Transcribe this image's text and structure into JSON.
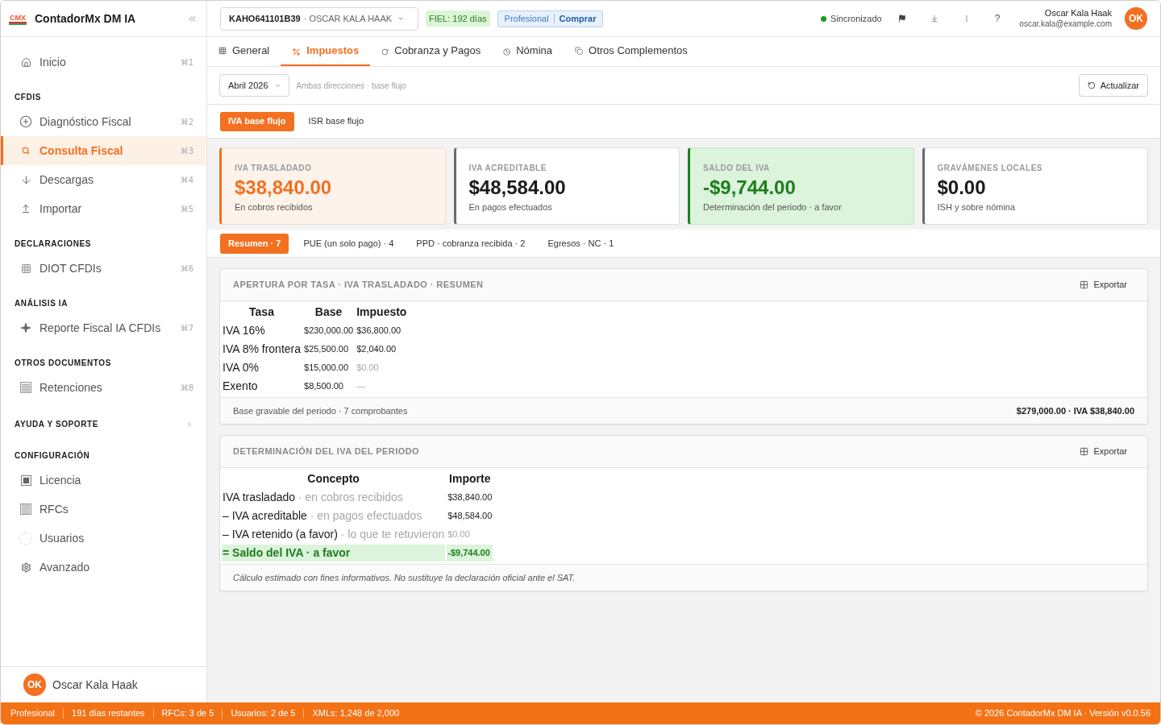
{
  "sidebar": {
    "logo": "CMX",
    "title": "ContadorMx DM IA",
    "nav": [
      {
        "kind": "item",
        "label": "Inicio",
        "shortcut": "⌘1",
        "selected": false
      },
      {
        "kind": "section",
        "label": "CFDIS"
      },
      {
        "kind": "item",
        "label": "Diagnóstico Fiscal",
        "shortcut": "⌘2",
        "selected": false
      },
      {
        "kind": "item",
        "label": "Consulta Fiscal",
        "shortcut": "⌘3",
        "selected": true
      },
      {
        "kind": "item",
        "label": "Descargas",
        "shortcut": "⌘4",
        "selected": false
      },
      {
        "kind": "item",
        "label": "Importar",
        "shortcut": "⌘5",
        "selected": false
      },
      {
        "kind": "section",
        "label": "DECLARACIONES"
      },
      {
        "kind": "item",
        "label": "DIOT CFDIs",
        "shortcut": "⌘6",
        "selected": false
      },
      {
        "kind": "section",
        "label": "ANÁLISIS IA"
      },
      {
        "kind": "item",
        "label": "Reporte Fiscal IA CFDIs",
        "shortcut": "⌘7",
        "selected": false
      },
      {
        "kind": "section",
        "label": "OTROS DOCUMENTOS"
      },
      {
        "kind": "item",
        "label": "Retenciones",
        "shortcut": "⌘8",
        "selected": false
      },
      {
        "kind": "group",
        "label": "AYUDA Y SOPORTE",
        "expanded": false
      },
      {
        "kind": "section",
        "label": "CONFIGURACIÓN"
      },
      {
        "kind": "item",
        "label": "Licencia",
        "selected": false
      },
      {
        "kind": "item",
        "label": "RFCs",
        "selected": false
      },
      {
        "kind": "item",
        "label": "Usuarios",
        "selected": false
      },
      {
        "kind": "item",
        "label": "Avanzado",
        "selected": false
      }
    ],
    "user": {
      "initials": "OK",
      "name": "Oscar Kala Haak"
    }
  },
  "topbar": {
    "rfc": {
      "code": "KAHO641101B39",
      "name": "· OSCAR KALA HAAK"
    },
    "fiel": "FIEL: 192 días",
    "plan": {
      "label": "Profesional",
      "action": "Comprar"
    },
    "sync": {
      "label": "Sincronizado",
      "online": true
    },
    "help": "?",
    "user": {
      "name": "Oscar Kala Haak",
      "email": "oscar.kala@example.com",
      "initials": "OK"
    }
  },
  "tabs": [
    {
      "label": "General",
      "selected": false
    },
    {
      "label": "Impuestos",
      "selected": true
    },
    {
      "label": "Cobranza y Pagos",
      "selected": false
    },
    {
      "label": "Nómina",
      "selected": false
    },
    {
      "label": "Otros Complementos",
      "selected": false
    }
  ],
  "toolbar": {
    "period": "Abril 2026",
    "note": "Ambas direcciones · base flujo",
    "refresh": "Actualizar"
  },
  "subtabs": [
    {
      "label": "IVA base flujo",
      "selected": true
    },
    {
      "label": "ISR base flujo",
      "selected": false
    }
  ],
  "cards": [
    {
      "kind": "accent",
      "label": "IVA TRASLADADO",
      "value": "$38,840.00",
      "caption": "En cobros recibidos"
    },
    {
      "kind": "neutral",
      "label": "IVA ACREDITABLE",
      "value": "$48,584.00",
      "caption": "En pagos efectuados"
    },
    {
      "kind": "positive",
      "label": "SALDO DEL IVA",
      "value": "-$9,744.00",
      "caption": "Determinación del periodo · a favor"
    },
    {
      "kind": "neutral",
      "label": "GRAVÁMENES LOCALES",
      "value": "$0.00",
      "caption": "ISH y sobre nómina"
    }
  ],
  "filters": [
    {
      "label": "Resumen · 7",
      "selected": true
    },
    {
      "label": "PUE (un solo pago) · 4",
      "selected": false
    },
    {
      "label": "PPD · cobranza recibida · 2",
      "selected": false
    },
    {
      "label": "Egresos · NC · 1",
      "selected": false
    }
  ],
  "rates_panel": {
    "title": "APERTURA POR TASA · IVA TRASLADADO · RESUMEN",
    "export": "Exportar",
    "columns": [
      "Tasa",
      "Base",
      "Impuesto"
    ],
    "rows": [
      {
        "rate": "IVA 16%",
        "base": "$230,000.00",
        "tax": "$36,800.00",
        "muted": false
      },
      {
        "rate": "IVA 8% frontera",
        "base": "$25,500.00",
        "tax": "$2,040.00",
        "muted": false
      },
      {
        "rate": "IVA 0%",
        "base": "$15,000.00",
        "tax": "$0.00",
        "muted": true
      },
      {
        "rate": "Exento",
        "base": "$8,500.00",
        "tax": "—",
        "muted": true
      }
    ],
    "summary": "Base gravable del periodo · 7 comprobantes",
    "total": "$279,000.00 · IVA $38,840.00"
  },
  "determination_panel": {
    "title": "DETERMINACIÓN DEL IVA DEL PERIODO",
    "export": "Exportar",
    "columns": [
      "Concepto",
      "Importe"
    ],
    "rows": [
      {
        "kind": "line",
        "concept": "IVA trasladado",
        "note": "· en cobros recibidos",
        "amount": "$38,840.00",
        "muted": false
      },
      {
        "kind": "line",
        "concept": "– IVA acreditable",
        "note": "· en pagos efectuados",
        "amount": "$48,584.00",
        "muted": false
      },
      {
        "kind": "line",
        "concept": "– IVA retenido (a favor)",
        "note": "· lo que te retuvieron",
        "amount": "$0.00",
        "muted": true
      },
      {
        "kind": "total",
        "concept": "= Saldo del IVA · a favor",
        "amount": "-$9,744.00",
        "muted": false
      }
    ],
    "disclaimer": "Cálculo estimado con fines informativos. No sustituye la declaración oficial ante el SAT."
  },
  "status_bar": {
    "items": [
      "Profesional",
      "191 días restantes",
      "RFCs: 3 de 5",
      "Usuarios: 2 de 5",
      "XMLs: 1,248 de 2,000"
    ],
    "copyright": "© 2026 ContadorMx DM IA · Versión v0.0.56"
  }
}
